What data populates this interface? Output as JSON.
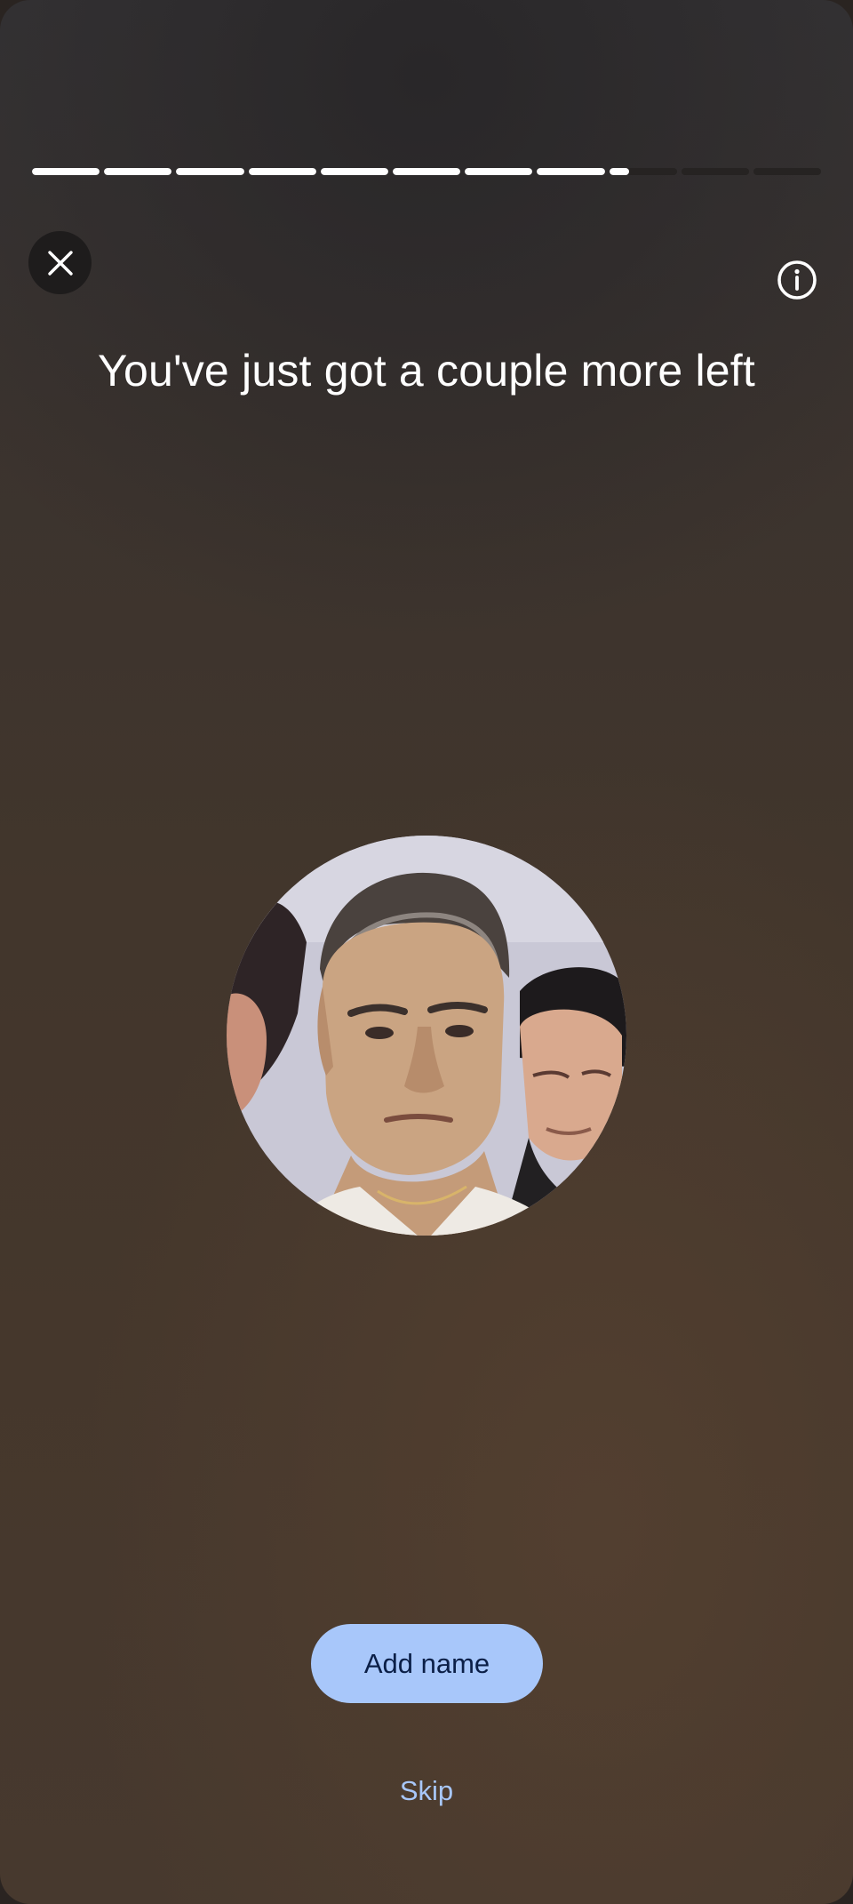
{
  "header": {
    "progress": {
      "total_segments": 11,
      "completed_segments": 8,
      "partial_segment_fraction": 0.3
    },
    "close_icon": "close-icon",
    "info_icon": "info-icon"
  },
  "main": {
    "title": "You've just got a couple more left",
    "face_image": "face-photo"
  },
  "actions": {
    "add_name_label": "Add name",
    "skip_label": "Skip"
  },
  "colors": {
    "accent": "#a8c7fa",
    "accent_text": "#0b1f47",
    "progress_fill": "#ffffff",
    "progress_track": "#262322"
  }
}
